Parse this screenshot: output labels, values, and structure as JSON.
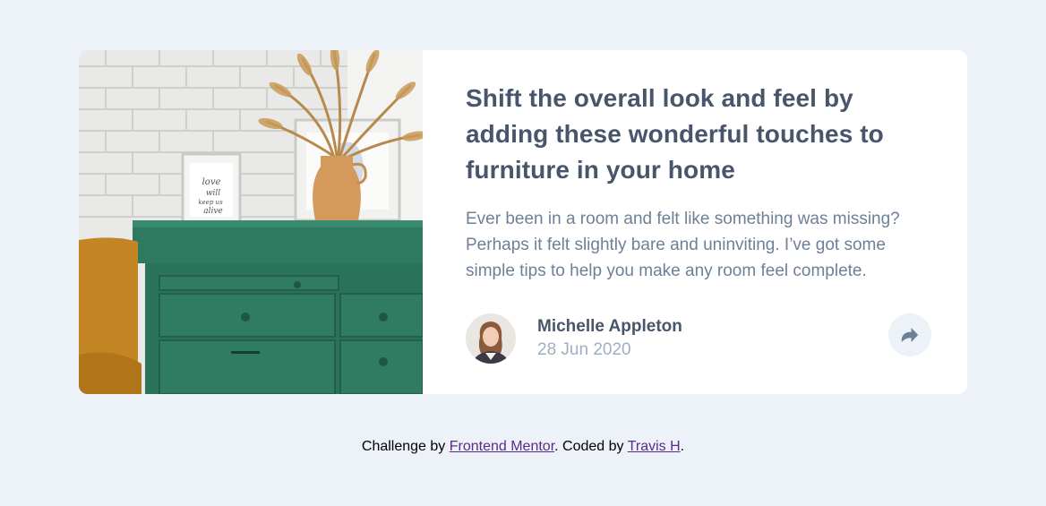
{
  "card": {
    "image_name": "drawers-image",
    "title": "Shift the overall look and feel by adding these wonderful touches to furniture in your home",
    "description": "Ever been in a room and felt like something was missing? Perhaps it felt slightly bare and uninviting. I’ve got some simple tips to help you make any room feel complete.",
    "author": {
      "name": "Michelle Appleton",
      "date": "28 Jun 2020"
    },
    "share_icon": "share-icon"
  },
  "footer": {
    "prefix": "Challenge by ",
    "link1": "Frontend Mentor",
    "middle": ". Coded by ",
    "link2": "Travis H",
    "suffix": "."
  },
  "colors": {
    "background": "#ecf2f8",
    "card": "#ffffff",
    "title": "#48556a",
    "text": "#6e8098",
    "muted": "#9eafc2",
    "link": "#5c2a8c"
  }
}
